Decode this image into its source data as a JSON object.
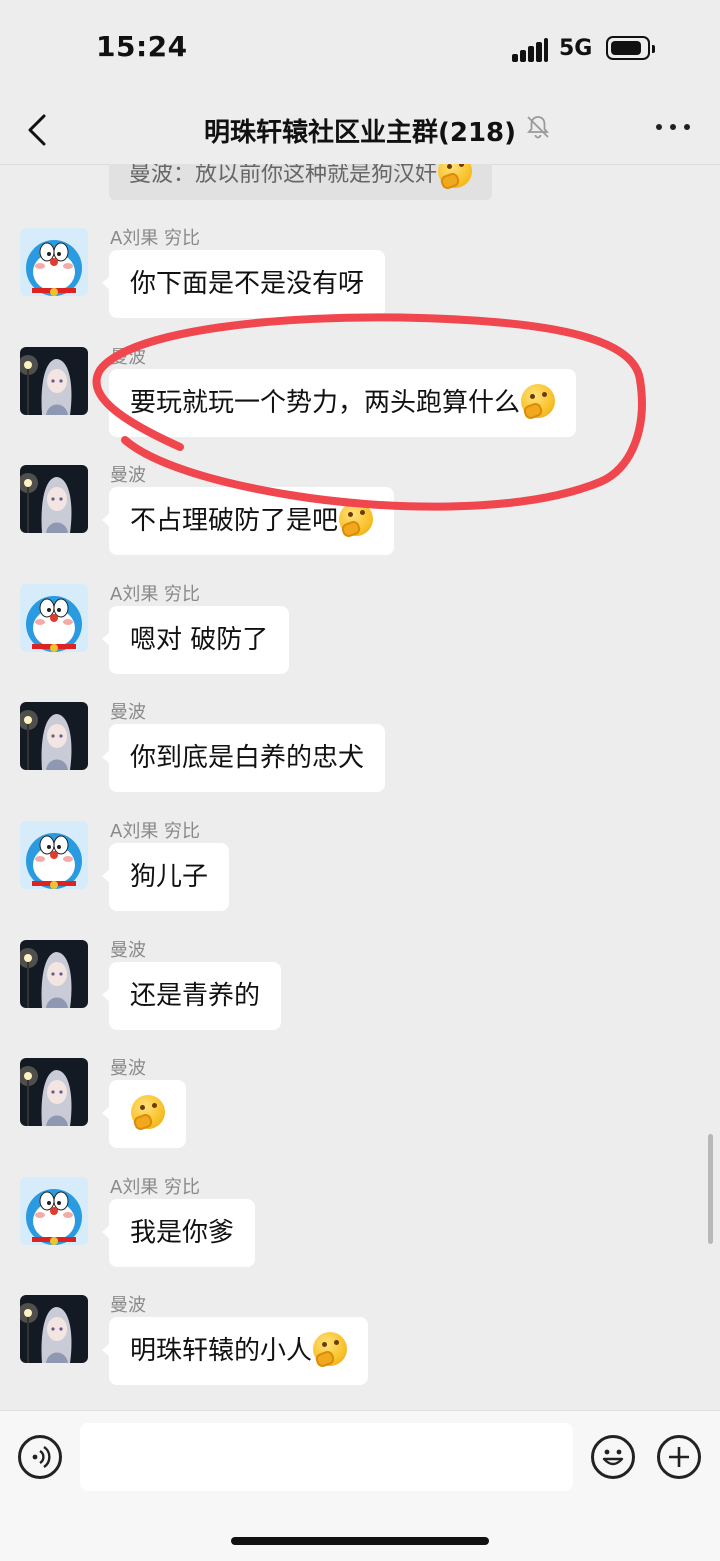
{
  "status_bar": {
    "time": "15:24",
    "network": "5G"
  },
  "header": {
    "title": "明珠轩辕社区业主群(218)"
  },
  "quoted_message": "曼波：放以前你这种就是狗汉奸",
  "messages": [
    {
      "sender": "A刘果 穷比",
      "avatar": "doraemon",
      "text": "你下面是不是没有呀",
      "emoji": false
    },
    {
      "sender": "曼波",
      "avatar": "anime-girl",
      "text": "要玩就玩一个势力，两头跑算什么",
      "emoji": true
    },
    {
      "sender": "曼波",
      "avatar": "anime-girl",
      "text": "不占理破防了是吧",
      "emoji": true
    },
    {
      "sender": "A刘果 穷比",
      "avatar": "doraemon",
      "text": "嗯对 破防了",
      "emoji": false
    },
    {
      "sender": "曼波",
      "avatar": "anime-girl",
      "text": "你到底是白养的忠犬",
      "emoji": false
    },
    {
      "sender": "A刘果 穷比",
      "avatar": "doraemon",
      "text": "狗儿子",
      "emoji": false
    },
    {
      "sender": "曼波",
      "avatar": "anime-girl",
      "text": "还是青养的",
      "emoji": false
    },
    {
      "sender": "曼波",
      "avatar": "anime-girl",
      "text": "",
      "emoji": true
    },
    {
      "sender": "A刘果 穷比",
      "avatar": "doraemon",
      "text": "我是你爹",
      "emoji": false
    },
    {
      "sender": "曼波",
      "avatar": "anime-girl",
      "text": "明珠轩辕的小人",
      "emoji": true
    }
  ],
  "annotation": {
    "shape": "hand-drawn-ellipse",
    "color": "#f0474e"
  },
  "input_bar": {
    "placeholder": ""
  },
  "icons": [
    "back-arrow-icon",
    "mute-bell-icon",
    "more-icon",
    "voice-icon",
    "emoji-icon",
    "plus-icon"
  ]
}
